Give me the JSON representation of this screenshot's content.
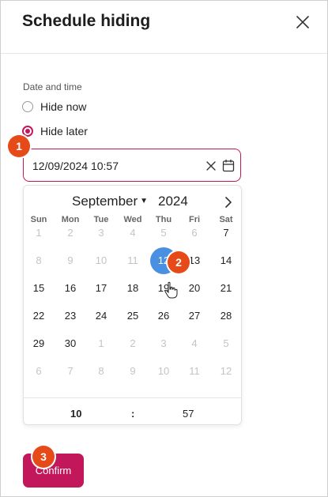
{
  "dialog": {
    "title": "Schedule hiding",
    "section_label": "Date and time",
    "options": [
      {
        "label": "Hide now",
        "checked": false
      },
      {
        "label": "Hide later",
        "checked": true
      }
    ],
    "datetime_value": "12/09/2024 10:57",
    "confirm_label": "Confirm",
    "accent_color": "#c2185b"
  },
  "calendar": {
    "month": "September",
    "year": "2024",
    "weekdays": [
      "Sun",
      "Mon",
      "Tue",
      "Wed",
      "Thu",
      "Fri",
      "Sat"
    ],
    "weeks": [
      [
        "1",
        "2",
        "3",
        "4",
        "5",
        "6",
        "7"
      ],
      [
        "8",
        "9",
        "10",
        "11",
        "12",
        "13",
        "14"
      ],
      [
        "15",
        "16",
        "17",
        "18",
        "19",
        "20",
        "21"
      ],
      [
        "22",
        "23",
        "24",
        "25",
        "26",
        "27",
        "28"
      ],
      [
        "29",
        "30",
        "1",
        "2",
        "3",
        "4",
        "5"
      ],
      [
        "6",
        "7",
        "8",
        "9",
        "10",
        "11",
        "12"
      ]
    ],
    "muted": [
      [
        true,
        true,
        true,
        true,
        true,
        true,
        false
      ],
      [
        true,
        true,
        true,
        true,
        false,
        false,
        false
      ],
      [
        false,
        false,
        false,
        false,
        false,
        false,
        false
      ],
      [
        false,
        false,
        false,
        false,
        false,
        false,
        false
      ],
      [
        false,
        false,
        true,
        true,
        true,
        true,
        true
      ],
      [
        true,
        true,
        true,
        true,
        true,
        true,
        true
      ]
    ],
    "selected_day": "12",
    "selected_color": "#4a90e2",
    "time": {
      "hour": "10",
      "separator": ":",
      "minute": "57"
    }
  },
  "badges": [
    "1",
    "2",
    "3"
  ],
  "icons": {
    "close": "close-icon",
    "clear": "clear-icon",
    "calendar": "calendar-icon",
    "next": "chevron-right-icon",
    "month_dropdown": "chevron-down-icon",
    "pointer": "hand-pointer-icon"
  }
}
